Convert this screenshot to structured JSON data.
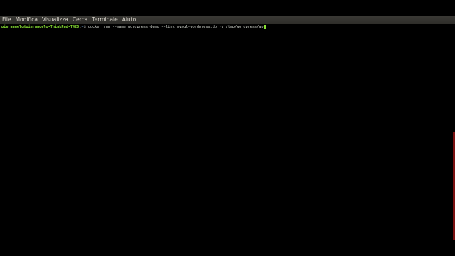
{
  "menubar": {
    "items": [
      {
        "label": "File"
      },
      {
        "label": "Modifica"
      },
      {
        "label": "Visualizza"
      },
      {
        "label": "Cerca"
      },
      {
        "label": "Terminale"
      },
      {
        "label": "Aiuto"
      }
    ]
  },
  "terminal": {
    "prompt_user_host": "pierangelo@pierangelo-ThinkPad-T420",
    "prompt_sep": ":",
    "prompt_path": "~",
    "prompt_symbol": "$ ",
    "command": "docker run --name wordpress-demo --link mysql-wordpress:db -v /tmp/wordpress/wp",
    "colors": {
      "background": "#000000",
      "prompt_user": "#8ae234",
      "prompt_path": "#729fcf",
      "text": "#d3d7cf",
      "cursor": "#8ae234"
    }
  }
}
